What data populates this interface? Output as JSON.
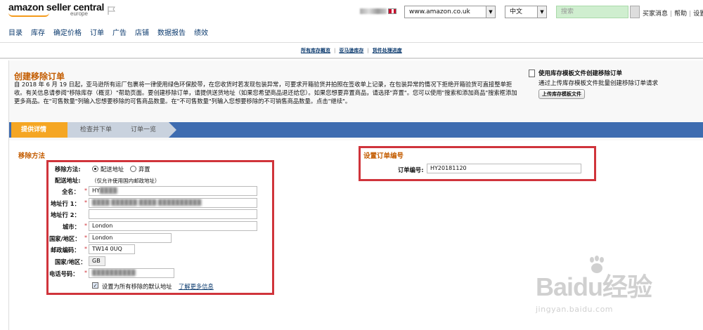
{
  "header": {
    "logo_text": "amazon seller central",
    "logo_sub": "europe",
    "marketplace": "www.amazon.co.uk",
    "language": "中文",
    "search_placeholder": "搜索",
    "links": [
      "买家消息",
      "帮助",
      "设置"
    ]
  },
  "nav": {
    "items": [
      "目录",
      "库存",
      "确定价格",
      "订单",
      "广告",
      "店铺",
      "数据报告",
      "绩效"
    ]
  },
  "sublinks": [
    "所有库存概览",
    "亚马逊库存",
    "货件处理进度"
  ],
  "page": {
    "title": "创建移除订单",
    "description": "自 2018 年 6 月 19 日起，亚马逊所有运厂包裹将一律使用绿色环保胶带，在您收货时若发现包装异常，可要求开箱验货并拍照在签收单上记录，在包装异常的情况下拒绝开箱验货可直接整单拒收。有关信息请参阅\"移除库存（概览）\"帮助页面。要创建移除订单，请提供送货地址（如果您希望商品退还给您）。如果您想要弃置商品，请选择\"弃置\"。您可以使用\"搜索和添加商品\"搜索框添加更多商品。在\"可售数量\"列输入您想要移除的可售商品数量。在\"不可售数量\"列输入您想要移除的不可销售商品数量。点击\"继续\"。"
  },
  "side_box": {
    "title": "使用库存模板文件创建移除订单",
    "subtitle": "通过上传库存模板文件批量创建移除订单请求",
    "button": "上传库存模板文件"
  },
  "steps": [
    "提供详情",
    "检查并下单",
    "订单一览"
  ],
  "removal_method": {
    "section_title": "移除方法",
    "method_label": "移除方法:",
    "options": [
      "配送地址",
      "弃置"
    ],
    "selected": "配送地址",
    "address_label": "配送地址:",
    "address_note": "（仅允许使用国内邮政地址）",
    "fields": [
      {
        "label": "全名：",
        "value": "HY",
        "required": true
      },
      {
        "label": "地址行 1：",
        "value": "",
        "required": true
      },
      {
        "label": "地址行 2：",
        "value": "",
        "required": false
      },
      {
        "label": "城市：",
        "value": "London",
        "required": true
      },
      {
        "label": "国家/地区：",
        "value": "London",
        "required": true
      },
      {
        "label": "邮政编码：",
        "value": "TW14 0UQ",
        "required": true
      },
      {
        "label": "国家/地区：",
        "value": "GB",
        "required": false
      },
      {
        "label": "电话号码：",
        "value": "",
        "required": true
      }
    ],
    "default_checkbox_label": "设置为所有移除的默认地址",
    "learn_more": "了解更多信息"
  },
  "order_ref": {
    "section_title": "设置订单编号",
    "label": "订单编号:",
    "value": "HY20181120"
  },
  "watermark": {
    "logo": "Baidu经验",
    "url": "jingyan.baidu.com"
  }
}
